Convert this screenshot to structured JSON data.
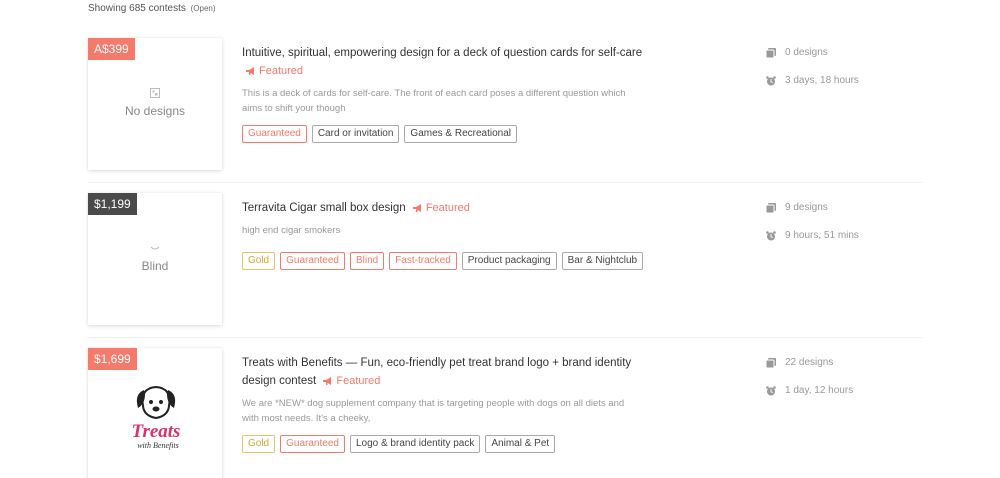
{
  "header": {
    "showing": "Showing 685 contests",
    "filter": "(Open)"
  },
  "icons": {
    "designs": "gallery-icon",
    "time": "alarm-clock-icon",
    "featured": "megaphone-icon"
  },
  "colors": {
    "accent": "#f47a6b",
    "dark_prize": "#4a4a4a",
    "gold": "#d1a93a"
  },
  "contests": [
    {
      "prize": "A$399",
      "card_label": "No designs",
      "title": "Intuitive, spiritual, empowering design for a deck of question cards for self-care",
      "featured": "Featured",
      "description": "This is a deck of cards for self-care. The front of each card poses a different question which aims to shift your though",
      "tags": [
        "Guaranteed",
        "Card or invitation",
        "Games & Recreational"
      ],
      "designs": "0 designs",
      "time_left": "3 days, 18 hours"
    },
    {
      "prize": "$1,199",
      "card_label": "Blind",
      "title": "Terravita Cigar small box design",
      "featured": "Featured",
      "description": "high end cigar smokers",
      "tags": [
        "Gold",
        "Guaranteed",
        "Blind",
        "Fast-tracked",
        "Product packaging",
        "Bar & Nightclub"
      ],
      "designs": "9 designs",
      "time_left": "9 hours, 51 mins"
    },
    {
      "prize": "$1,699",
      "logo_text": [
        "Treats",
        "with Benefits"
      ],
      "title": "Treats with Benefits — Fun, eco-friendly pet treat brand logo + brand identity design contest",
      "featured": "Featured",
      "description": "We are *NEW* dog supplement company that is targeting people with dogs on all diets and with most needs. It's a cheeky,",
      "tags": [
        "Gold",
        "Guaranteed",
        "Logo & brand identity pack",
        "Animal & Pet"
      ],
      "designs": "22 designs",
      "time_left": "1 day, 12 hours"
    }
  ]
}
